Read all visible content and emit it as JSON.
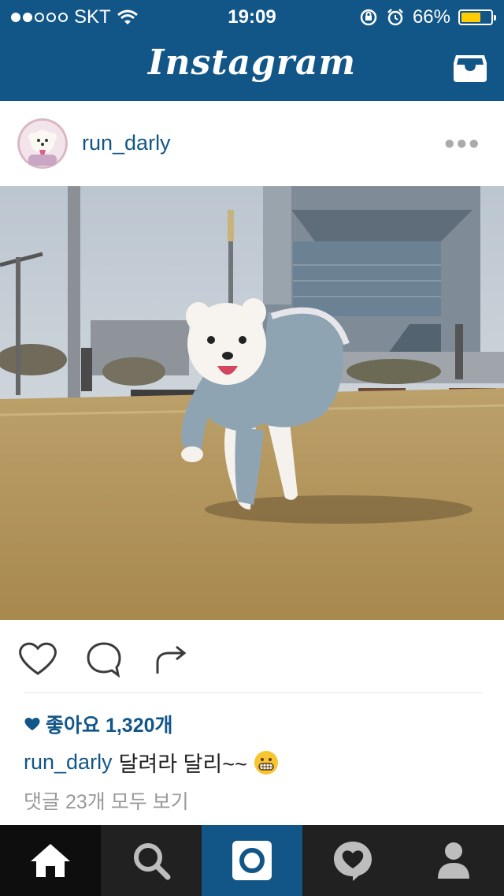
{
  "status_bar": {
    "carrier": "SKT",
    "time": "19:09",
    "battery": "66%",
    "battery_level": 0.66
  },
  "app": {
    "title": "Instagram"
  },
  "post": {
    "username": "run_darly",
    "likes_text": "좋아요 1,320개",
    "caption_user": "run_darly",
    "caption_text": "달려라 달리~~",
    "comments_link": "댓글 23개 모두 보기"
  },
  "colors": {
    "brand": "#125688",
    "tab_bar": "#212121",
    "battery": "#ffcc00"
  },
  "icons": [
    "wifi-icon",
    "rotation-lock-icon",
    "alarm-icon",
    "inbox-icon",
    "more-icon",
    "heart-icon",
    "comment-icon",
    "share-icon",
    "grin-emoji",
    "home-icon",
    "search-icon",
    "camera-icon",
    "activity-icon",
    "profile-icon"
  ]
}
